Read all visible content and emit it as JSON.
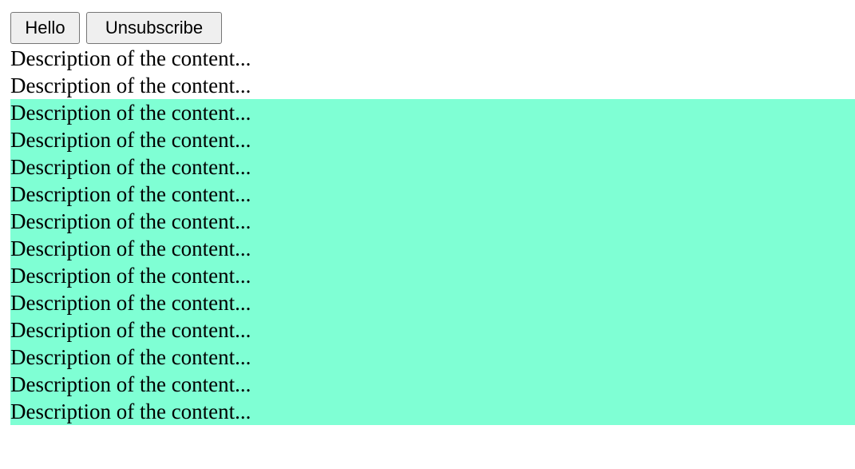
{
  "buttons": {
    "hello_label": "Hello",
    "unsubscribe_label": "Unsubscribe"
  },
  "content": {
    "plain_lines": [
      "Description of the content...",
      "Description of the content..."
    ],
    "highlighted_lines": [
      "Description of the content...",
      "Description of the content...",
      "Description of the content...",
      "Description of the content...",
      "Description of the content...",
      "Description of the content...",
      "Description of the content...",
      "Description of the content...",
      "Description of the content...",
      "Description of the content...",
      "Description of the content...",
      "Description of the content..."
    ]
  },
  "colors": {
    "highlight": "#7fffd4",
    "background": "#ffffff",
    "text": "#000000"
  }
}
